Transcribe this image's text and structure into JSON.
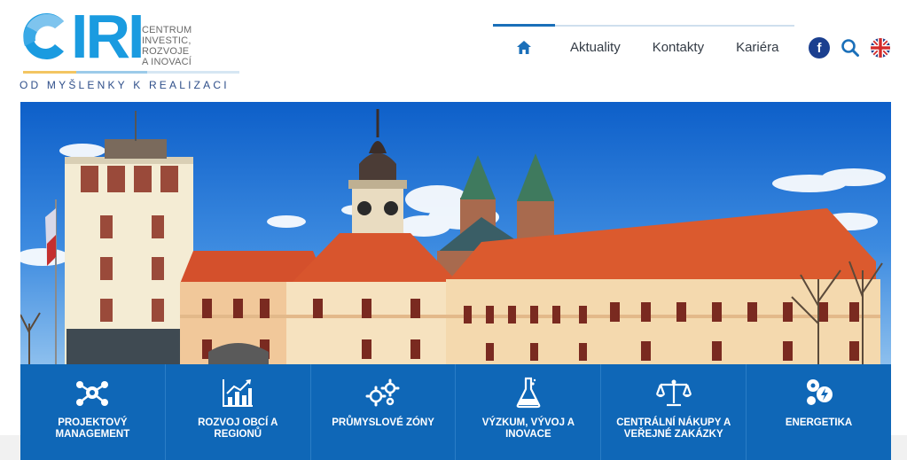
{
  "brand": {
    "logo_text": "CIRI",
    "subtitle_line1": "CENTRUM",
    "subtitle_line2": "INVESTIC, ROZVOJE",
    "subtitle_line3": "A INOVACÍ",
    "tagline": "OD MYŠLENKY K REALIZACI",
    "colors": {
      "primary": "#1a9be0",
      "dark_blue": "#2f4f8a",
      "accent_yellow": "#f3c562",
      "accent_light": "#9ccbe9"
    }
  },
  "nav": {
    "home_icon": "home-icon",
    "items": [
      "Aktuality",
      "Kontakty",
      "Kariéra"
    ],
    "active_color": "#1a6fb9"
  },
  "tools": {
    "facebook_label": "f",
    "search_icon": "search-icon",
    "language_icon": "uk-flag-icon"
  },
  "categories": [
    {
      "label": "PROJEKTOVÝ MANAGEMENT",
      "icon": "project-network-icon"
    },
    {
      "label": "ROZVOJ OBCÍ A REGIONŮ",
      "icon": "growth-chart-icon"
    },
    {
      "label": "PRŮMYSLOVÉ ZÓNY",
      "icon": "gears-icon"
    },
    {
      "label": "VÝZKUM, VÝVOJ A INOVACE",
      "icon": "flask-icon"
    },
    {
      "label": "CENTRÁLNÍ NÁKUPY A VEŘEJNÉ ZAKÁZKY",
      "icon": "scales-icon"
    },
    {
      "label": "ENERGETIKA",
      "icon": "energy-icon"
    }
  ],
  "category_bar_color": "#0f67b7"
}
